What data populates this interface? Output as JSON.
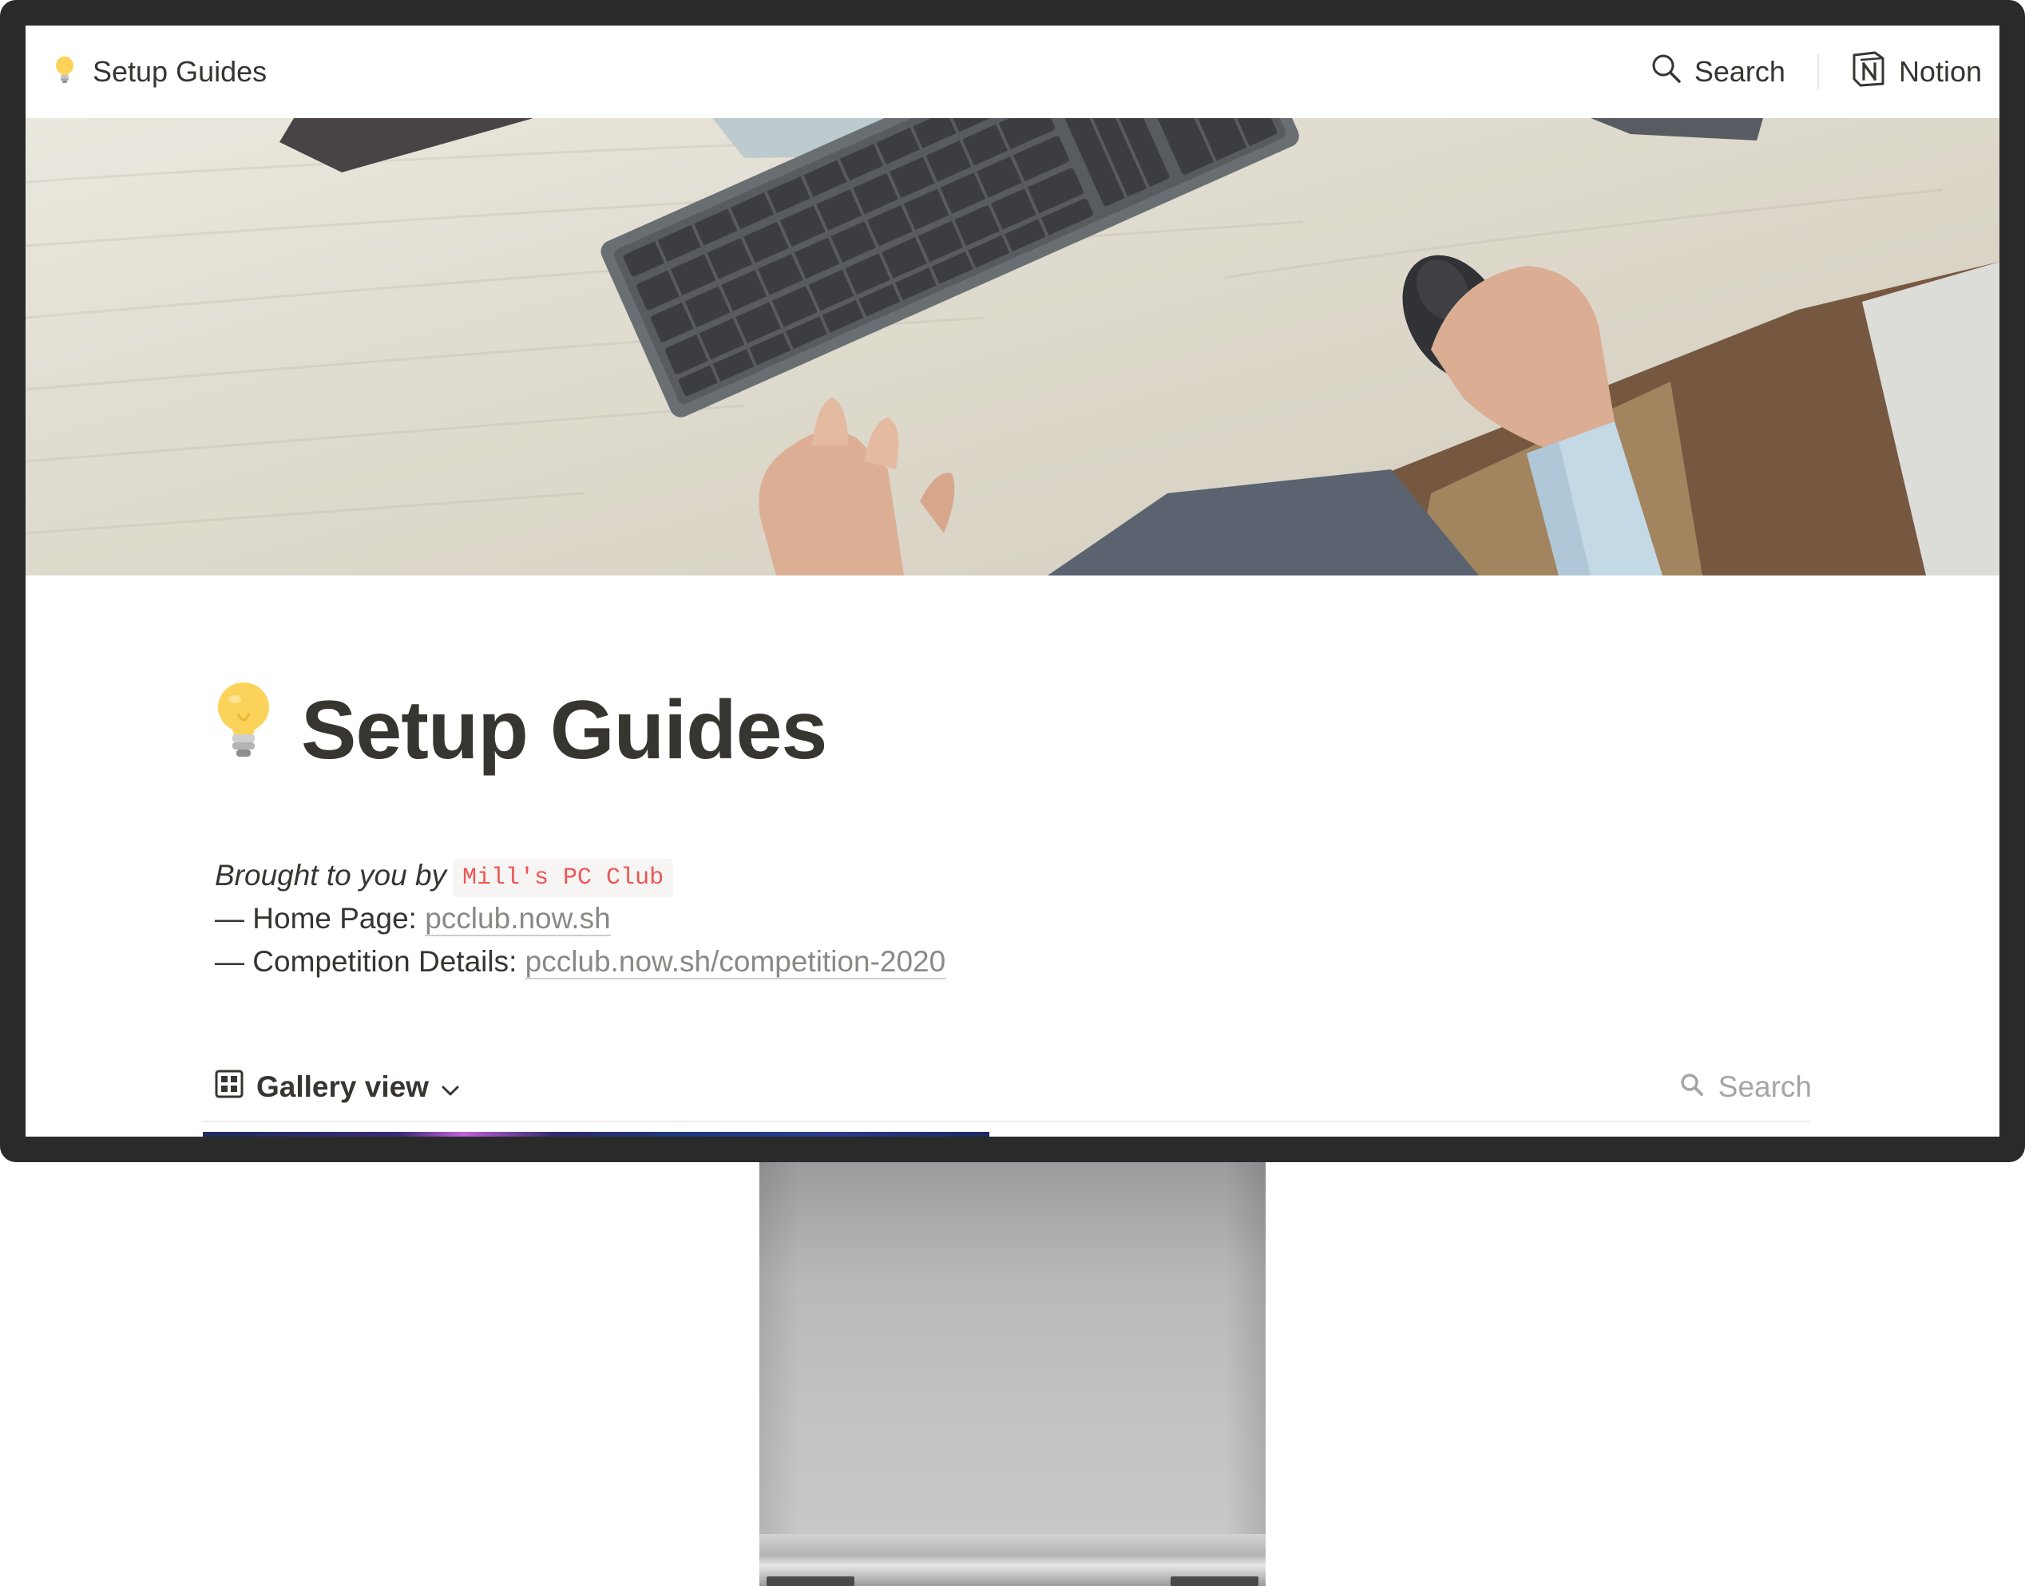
{
  "topbar": {
    "breadcrumb_title": "Setup Guides",
    "search_label": "Search",
    "notion_label": "Notion"
  },
  "page": {
    "title": "Setup Guides",
    "brought_by_label": "Brought to you by",
    "club_name": "Mill's PC Club",
    "home_prefix": "— Home Page: ",
    "home_link": "pcclub.now.sh",
    "competition_prefix": "— Competition Details: ",
    "competition_link": "pcclub.now.sh/competition-2020"
  },
  "database": {
    "view_label": "Gallery view",
    "search_placeholder": "Search"
  },
  "icons": {
    "page": "lightbulb-icon",
    "view": "gallery-grid-icon",
    "dropdown": "chevron-down-icon",
    "search": "search-icon",
    "brand": "notion-logo-icon"
  },
  "colors": {
    "text": "#37352f",
    "code_text": "#eb5757",
    "muted": "#a6a5a1",
    "bezel": "#2a2a2a"
  }
}
